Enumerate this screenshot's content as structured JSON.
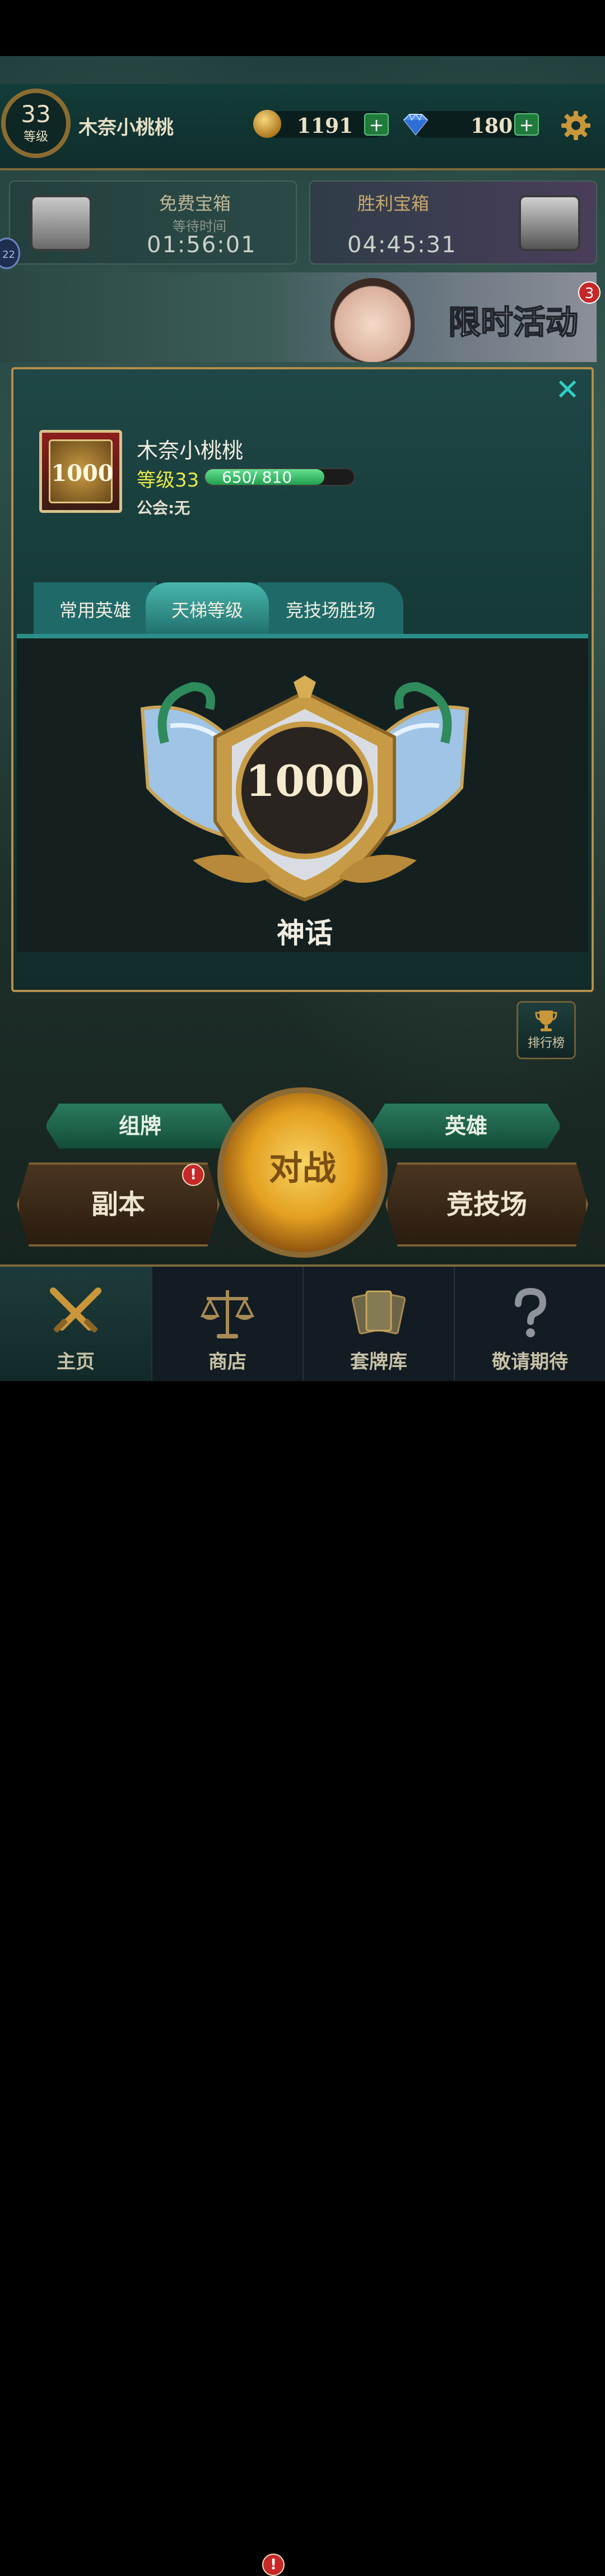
{
  "header": {
    "level_number": "33",
    "level_label": "等级",
    "player_name": "木奈小桃桃",
    "coins": "1191",
    "gems": "180",
    "plus_symbol": "+"
  },
  "chests": {
    "free": {
      "title": "免费宝箱",
      "subtitle": "等待时间",
      "timer": "01:56:01"
    },
    "victory": {
      "title": "胜利宝箱",
      "timer": "04:45:31"
    }
  },
  "side_badge": "22",
  "event_banner": {
    "label": "限时活动",
    "badge_count": "3"
  },
  "profile_modal": {
    "close_symbol": "✕",
    "avatar_rating": "1000",
    "player_name": "木奈小桃桃",
    "level_text": "等级33",
    "xp_text": "650/ 810",
    "xp_progress": 0.802,
    "guild_text": "公会:无",
    "tabs": [
      {
        "label": "常用英雄"
      },
      {
        "label": "天梯等级",
        "active": true
      },
      {
        "label": "竞技场胜场"
      }
    ],
    "rank_score": "1000",
    "rank_title": "神话"
  },
  "leaderboard_button": {
    "label": "排行榜"
  },
  "actions": {
    "deck": "组牌",
    "heroes": "英雄",
    "battle": "对战",
    "dungeon": "副本",
    "arena": "竞技场",
    "alert_symbol": "!"
  },
  "bottom_nav": [
    {
      "label": "主页",
      "icon": "crossed-swords-icon",
      "active": true
    },
    {
      "label": "商店",
      "icon": "scales-icon",
      "alert": "!"
    },
    {
      "label": "套牌库",
      "icon": "cards-icon"
    },
    {
      "label": "敬请期待",
      "icon": "question-mark-icon"
    }
  ],
  "colors": {
    "accent_gold": "#b38f4a",
    "teal": "#2fd1c7",
    "alert_red": "#c62828",
    "xp_green": "#21a050"
  }
}
